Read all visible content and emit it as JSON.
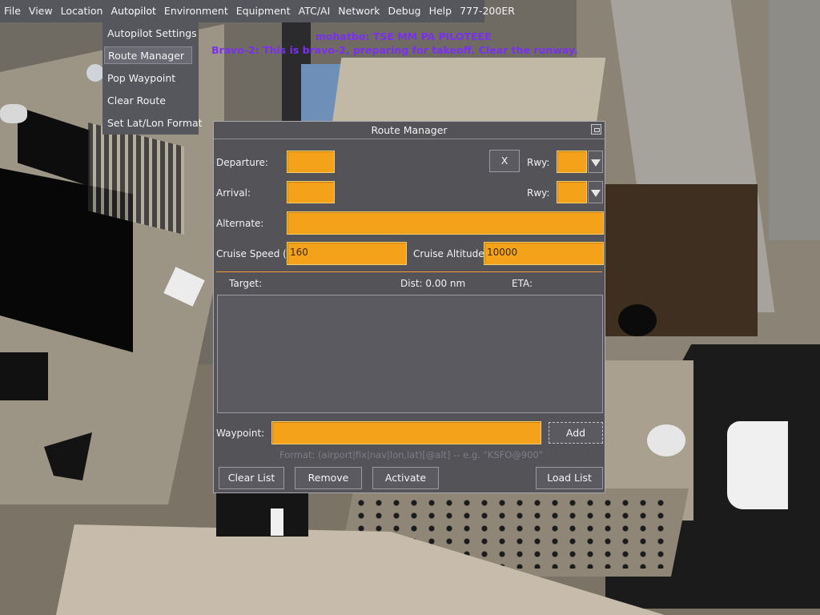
{
  "menubar": {
    "items": [
      "File",
      "View",
      "Location",
      "Autopilot",
      "Environment",
      "Equipment",
      "ATC/AI",
      "Network",
      "Debug",
      "Help",
      "777-200ER"
    ]
  },
  "autopilot_menu": {
    "items": [
      "Autopilot Settings",
      "Route Manager",
      "Pop Waypoint",
      "Clear Route",
      "Set Lat/Lon Format"
    ],
    "selected": "Route Manager"
  },
  "chat": {
    "line1": "mohatbo: TSE MM PA PILOTEEE",
    "line2": "Bravo-2: This is bravo-2, preparing for takeoff. Clear the runway."
  },
  "route_manager": {
    "title": "Route Manager",
    "departure_label": "Departure:",
    "departure_value": "",
    "arrival_label": "Arrival:",
    "arrival_value": "",
    "clear_x_label": "X",
    "rwy_label": "Rwy:",
    "departure_rwy": "",
    "arrival_rwy": "",
    "alternate_label": "Alternate:",
    "alternate_value": "",
    "cruise_speed_label": "Cruise Speed (k",
    "cruise_speed_value": "160",
    "cruise_altitude_label": "Cruise Altitude",
    "cruise_altitude_value": "10000",
    "target_label": "Target:",
    "dist_label": "Dist: 0.00 nm",
    "eta_label": "ETA:",
    "waypoint_label": "Waypoint:",
    "waypoint_value": "",
    "add_label": "Add",
    "format_hint": "Format: (airport|fix|nav|lon,lat)[@alt] -- e.g. \"KSFO@900\"",
    "buttons": {
      "clear_list": "Clear List",
      "remove": "Remove",
      "activate": "Activate",
      "load_list": "Load List"
    }
  },
  "colors": {
    "field": "#f5a21b",
    "dialog_bg": "#545358",
    "chat_text": "#7b2ff0",
    "separator": "#f0a23a"
  }
}
